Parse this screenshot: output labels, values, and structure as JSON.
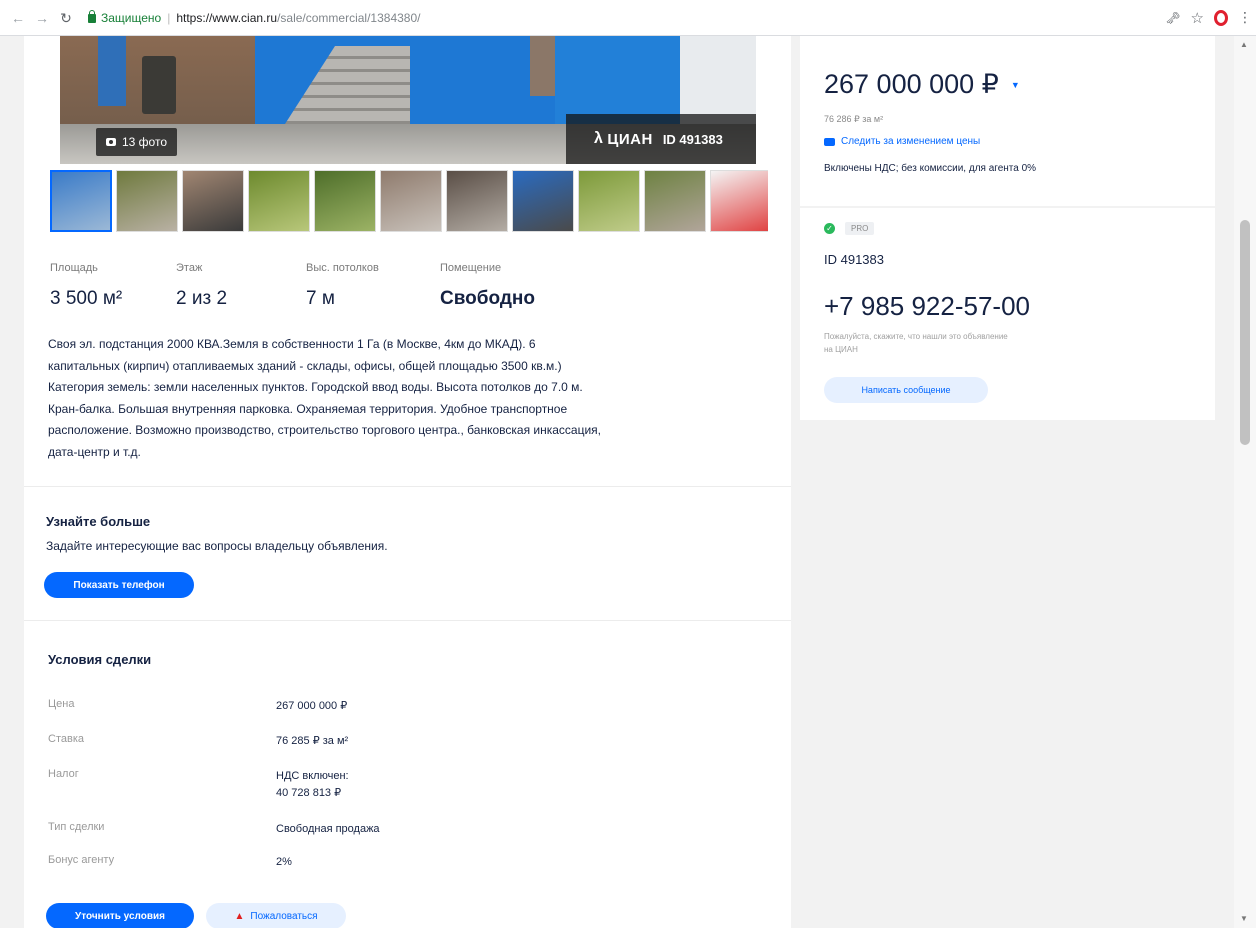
{
  "browser": {
    "secure_label": "Защищено",
    "url_host": "https://www.cian.ru",
    "url_path": "/sale/commercial/1384380/"
  },
  "gallery": {
    "photo_count": "13 фото",
    "watermark_logo": "ЦИАН",
    "watermark_id": "ID 491383",
    "thumbnails": [
      {
        "colors": [
          "#3a7bc8",
          "#9bb8d6"
        ]
      },
      {
        "colors": [
          "#6f7a3e",
          "#b9b1a4"
        ]
      },
      {
        "colors": [
          "#a18672",
          "#3a3a3a"
        ]
      },
      {
        "colors": [
          "#6d8a2e",
          "#b8c77a"
        ]
      },
      {
        "colors": [
          "#4e6e2a",
          "#9cb365"
        ]
      },
      {
        "colors": [
          "#8f7b6d",
          "#c9c2bb"
        ]
      },
      {
        "colors": [
          "#5a4e46",
          "#b3aca4"
        ]
      },
      {
        "colors": [
          "#2a6bc0",
          "#4a4a4a"
        ]
      },
      {
        "colors": [
          "#7d9a3a",
          "#c0cc8a"
        ]
      },
      {
        "colors": [
          "#6e8242",
          "#b1a59a"
        ]
      },
      {
        "colors": [
          "#f4f4f4",
          "#e04040"
        ]
      }
    ]
  },
  "facts": [
    {
      "label": "Площадь",
      "value": "3 500 м²"
    },
    {
      "label": "Этаж",
      "value": "2 из 2"
    },
    {
      "label": "Выс. потолков",
      "value": "7 м"
    },
    {
      "label": "Помещение",
      "value": "Свободно"
    }
  ],
  "description_lines": [
    "Своя эл. подстанция 2000 КВА.Земля в собственности 1 Га (в Москве, 4км до МКАД). 6",
    "капитальных (кирпич) отапливаемых зданий - склады, офисы, общей площадью 3500 кв.м.)",
    "Категория земель: земли населенных пунктов. Городской ввод воды. Высота потолков до 7.0 м.",
    "Кран-балка. Большая внутренняя парковка. Охраняемая территория. Удобное транспортное",
    "расположение. Возможно производство, строительство торгового центра., банковская инкассация,",
    "дата-центр и т.д."
  ],
  "learn_more": {
    "title": "Узнайте больше",
    "text": "Задайте интересующие вас вопросы владельцу объявления.",
    "button": "Показать телефон"
  },
  "terms": {
    "title": "Условия сделки",
    "rows": [
      {
        "label": "Цена",
        "value": "267 000 000 ₽"
      },
      {
        "label": "Ставка",
        "value": "76 285 ₽ за м²"
      },
      {
        "label": "Налог",
        "value": "НДС включен:",
        "value2": "40 728 813 ₽"
      },
      {
        "label": "Тип сделки",
        "value": "Свободная продажа"
      },
      {
        "label": "Бонус агенту",
        "value": "2%"
      }
    ],
    "clarify_button": "Уточнить условия",
    "complain_button": "Пожаловаться"
  },
  "sidebar": {
    "price": "267 000 000 ₽",
    "price_per_m": "76 286 ₽ за м²",
    "follow_link": "Следить за изменением цены",
    "vat_note": "Включены НДС; без комиссии, для агента 0%",
    "pro_badge": "PRO",
    "agent_id": "ID 491383",
    "phone": "+7 985 922-57-00",
    "phone_hint_1": "Пожалуйста, скажите, что нашли это объявление",
    "phone_hint_2": "на ЦИАН",
    "message_button": "Написать сообщение"
  }
}
